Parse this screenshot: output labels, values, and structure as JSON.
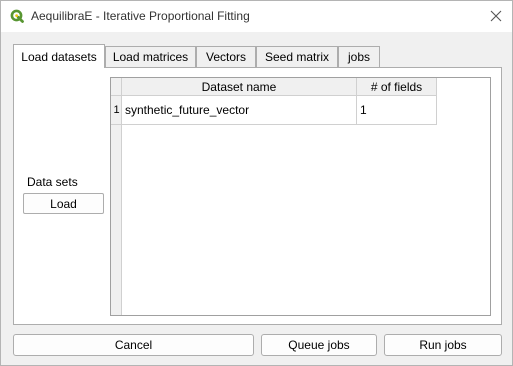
{
  "window": {
    "title": "AequilibraE - Iterative Proportional Fitting",
    "app_icon": "qgis-logo-icon",
    "close_icon": "close-icon"
  },
  "tabs": [
    {
      "label": "Load datasets",
      "active": true
    },
    {
      "label": "Load matrices",
      "active": false
    },
    {
      "label": "Vectors",
      "active": false
    },
    {
      "label": "Seed matrix",
      "active": false
    },
    {
      "label": "jobs",
      "active": false
    }
  ],
  "datasets_panel": {
    "side_label": "Data sets",
    "load_button": "Load",
    "table": {
      "columns": [
        "Dataset name",
        "# of fields"
      ],
      "rows": [
        {
          "row_number": "1",
          "cells": [
            "synthetic_future_vector",
            "1"
          ]
        }
      ]
    }
  },
  "footer": {
    "cancel": "Cancel",
    "queue_jobs": "Queue jobs",
    "run_jobs": "Run jobs"
  },
  "colors": {
    "qgis_green": "#589632",
    "qgis_yellow": "#eec90d"
  }
}
